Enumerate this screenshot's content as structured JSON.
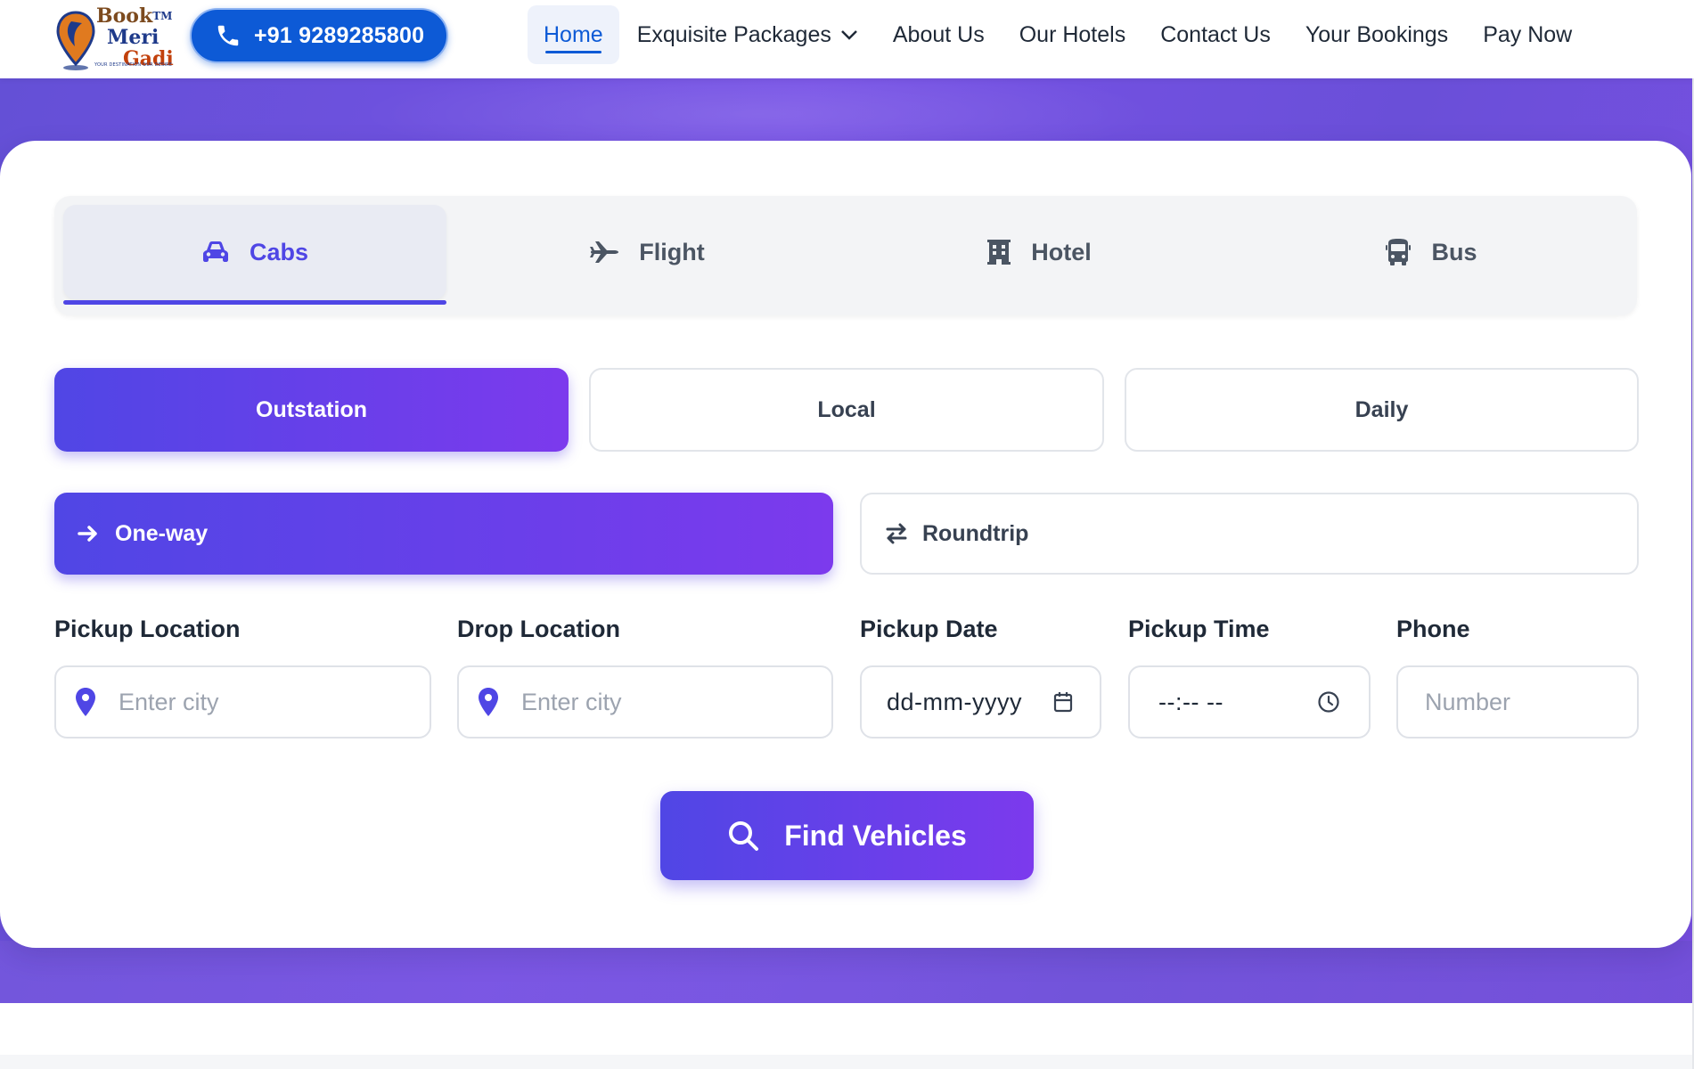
{
  "brand": {
    "logo_line1": "Book",
    "logo_tm": "TM",
    "logo_line2": "Meri",
    "logo_line3": "Gadi",
    "tagline": "YOUR DESTINATION OUR DESIRE"
  },
  "header": {
    "phone": "+91 9289285800",
    "nav": [
      {
        "label": "Home",
        "active": true
      },
      {
        "label": "Exquisite Packages"
      },
      {
        "label": "About Us"
      },
      {
        "label": "Our Hotels"
      },
      {
        "label": "Contact Us"
      },
      {
        "label": "Your Bookings"
      },
      {
        "label": "Pay Now"
      }
    ]
  },
  "tabs": [
    {
      "label": "Cabs",
      "icon": "car-icon",
      "active": true
    },
    {
      "label": "Flight",
      "icon": "plane-icon"
    },
    {
      "label": "Hotel",
      "icon": "building-icon"
    },
    {
      "label": "Bus",
      "icon": "bus-icon"
    }
  ],
  "modes": [
    {
      "label": "Outstation",
      "active": true
    },
    {
      "label": "Local"
    },
    {
      "label": "Daily"
    }
  ],
  "trip": {
    "oneway": "One-way",
    "roundtrip": "Roundtrip",
    "selected": "One-way"
  },
  "form": {
    "pickup_location": {
      "label": "Pickup Location",
      "placeholder": "Enter city"
    },
    "drop_location": {
      "label": "Drop Location",
      "placeholder": "Enter city"
    },
    "pickup_date": {
      "label": "Pickup Date",
      "value": "dd-mm-yyyy"
    },
    "pickup_time": {
      "label": "Pickup Time",
      "value": "--:-- --"
    },
    "phone": {
      "label": "Phone",
      "placeholder": "Number"
    }
  },
  "submit": "Find Vehicles",
  "colors": {
    "primary_blue": "#0d5ad6",
    "accent_start": "#5046e5",
    "accent_end": "#7c3aed",
    "hero_bg": "#6a4fd8"
  }
}
